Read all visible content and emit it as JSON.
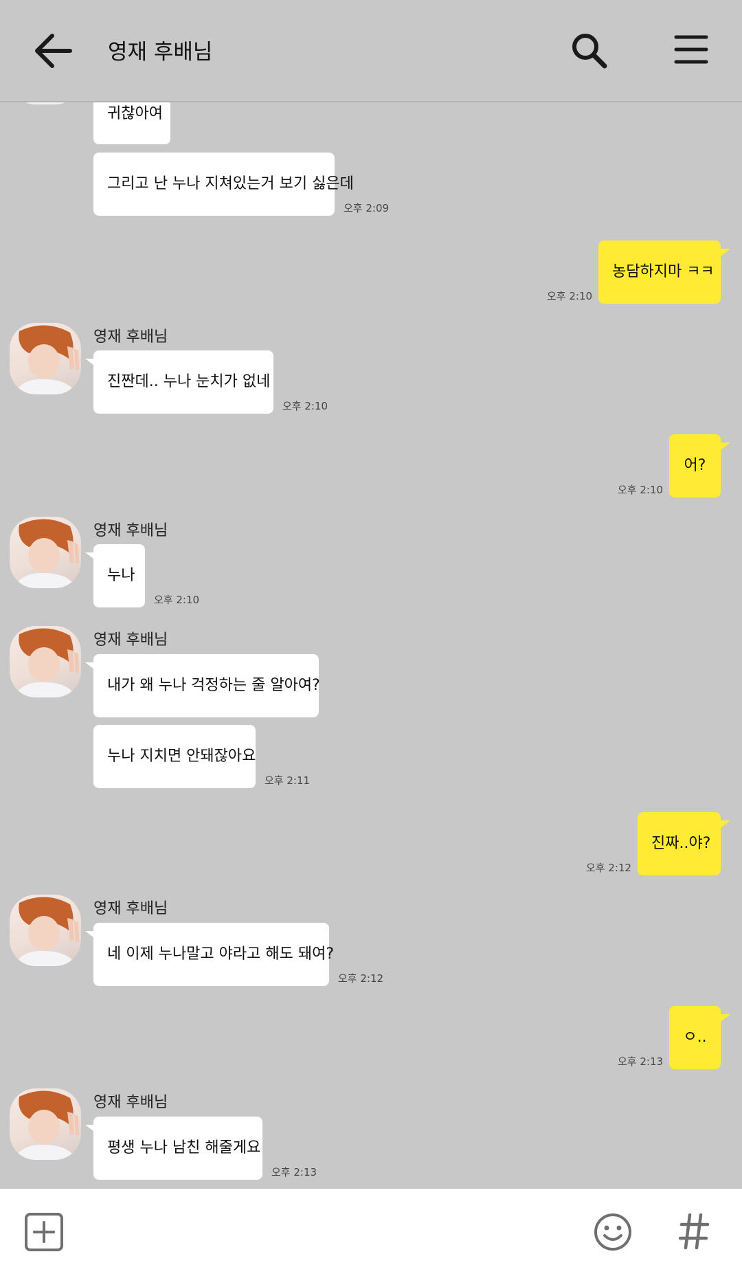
{
  "header": {
    "title": "영재 후배님",
    "back_icon": "arrow-left-icon",
    "search_icon": "search-icon",
    "menu_icon": "hamburger-menu-icon"
  },
  "messages": {
    "m1": {
      "text": "귀찮아여"
    },
    "m2": {
      "text": "그리고 난 누나 지쳐있는거 보기 싫은데",
      "time": "오후 2:09"
    },
    "m3": {
      "text": "농담하지마 ㅋㅋ",
      "time": "오후 2:10"
    },
    "g1": {
      "sender": "영재 후배님"
    },
    "m4": {
      "text": "진짠데.. 누나 눈치가 없네",
      "time": "오후 2:10"
    },
    "m5": {
      "text": "어?",
      "time": "오후 2:10"
    },
    "g2": {
      "sender": "영재 후배님"
    },
    "m6": {
      "text": "누나",
      "time": "오후 2:10"
    },
    "g3": {
      "sender": "영재 후배님"
    },
    "m7": {
      "text": "내가 왜 누나 걱정하는 줄 알아여?"
    },
    "m8": {
      "text": "누나 지치면 안돼잖아요",
      "time": "오후 2:11"
    },
    "m9": {
      "text": "진짜..야?",
      "time": "오후 2:12"
    },
    "g4": {
      "sender": "영재 후배님"
    },
    "m10": {
      "text": "네 이제 누나말고 야라고 해도 돼여?",
      "time": "오후 2:12"
    },
    "m11": {
      "text": "ㅇ..",
      "time": "오후 2:13"
    },
    "g5": {
      "sender": "영재 후배님"
    },
    "m12": {
      "text": "평생 누나 남친 해줄게요",
      "time": "오후 2:13"
    }
  },
  "bottom_bar": {
    "attach_icon": "plus-square-icon",
    "emoji_icon": "smiley-icon",
    "hash_icon": "hash-icon"
  },
  "colors": {
    "background": "#c8c8c8",
    "my_bubble": "#ffeb33",
    "their_bubble": "#ffffff"
  }
}
